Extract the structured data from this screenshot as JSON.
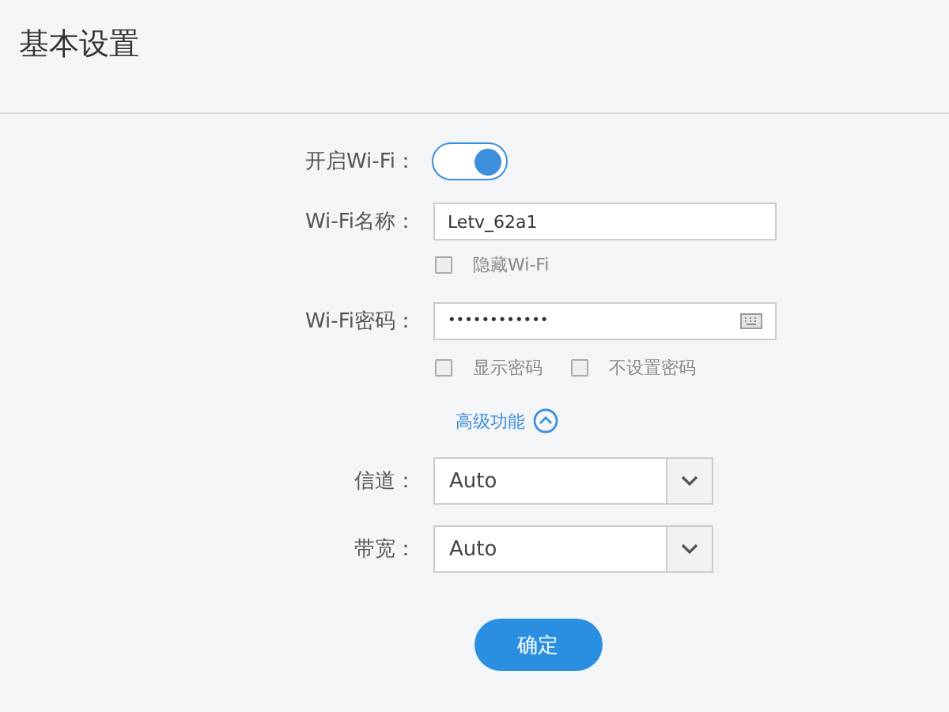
{
  "page": {
    "title": "基本设置"
  },
  "wifi_toggle": {
    "label": "开启Wi-Fi：",
    "on": true
  },
  "wifi_name": {
    "label": "Wi-Fi名称：",
    "value": "Letv_62a1"
  },
  "hide_wifi": {
    "label": "隐藏Wi-Fi",
    "checked": false
  },
  "wifi_password": {
    "label": "Wi-Fi密码：",
    "value": "••••••••••••"
  },
  "password_options": [
    {
      "label": "显示密码",
      "checked": false
    },
    {
      "label": "不设置密码",
      "checked": false
    }
  ],
  "advanced": {
    "label": "高级功能",
    "expanded": true
  },
  "selects": [
    {
      "label": "信道：",
      "value": "Auto"
    },
    {
      "label": "带宽：",
      "value": "Auto"
    }
  ],
  "confirm_button": {
    "label": "确定"
  }
}
